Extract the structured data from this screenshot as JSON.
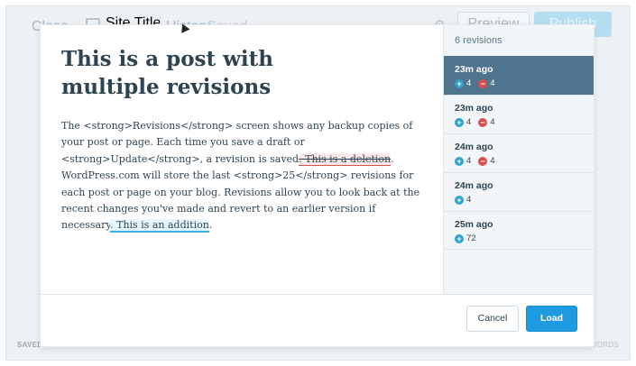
{
  "background": {
    "close_label": "Close",
    "site_title": "Site Title",
    "history_label": "History",
    "saved_label": "Saved",
    "preview_label": "Preview",
    "publish_label": "Publish",
    "footer_saved_strong": "SAVED",
    "footer_saved_rest": "27 MINUTES AGO",
    "footer_words": "43 WORDS"
  },
  "content": {
    "title": "This is a post with multiple revisions",
    "text_before": "The <strong>Revisions</strong> screen shows any backup copies of your post or page. Each time you save a draft or <strong>Update</strong>, a revision is saved",
    "deleted_text": ". This is a deletion",
    "text_middle": ". WordPress.com will store the last <strong>25</strong> revisions for each post or page on your blog. Revisions allow you to look back at the recent changes you've made and revert to an earlier version if necessary",
    "added_text": ". This is an addition",
    "text_end": "."
  },
  "sidebar": {
    "heading": "6 revisions",
    "revisions": [
      {
        "time": "23m ago",
        "added": "4",
        "removed": "4"
      },
      {
        "time": "23m ago",
        "added": "4",
        "removed": "4"
      },
      {
        "time": "24m ago",
        "added": "4",
        "removed": "4"
      },
      {
        "time": "24m ago",
        "added": "4"
      },
      {
        "time": "25m ago",
        "added": "72"
      }
    ]
  },
  "footer": {
    "cancel_label": "Cancel",
    "load_label": "Load"
  },
  "colors": {
    "selected_revision": "#4f748e",
    "primary_button": "#1e9be0",
    "added": "#2ea2cc",
    "removed": "#d94f4f"
  }
}
